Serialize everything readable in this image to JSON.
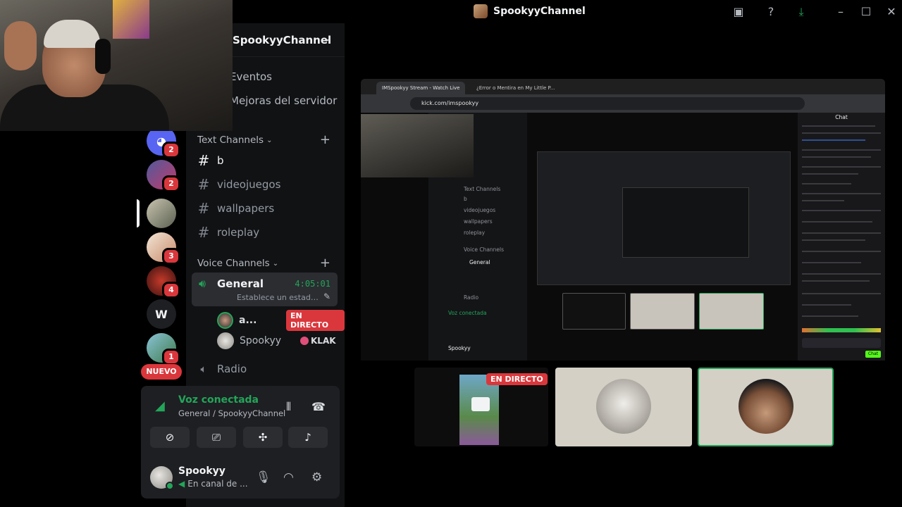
{
  "window": {
    "title": "SpookyyChannel",
    "icons": [
      "inbox-icon",
      "help-icon",
      "download-icon",
      "minimize-icon",
      "maximize-icon",
      "close-icon"
    ]
  },
  "servers": [
    {
      "name": "discord",
      "badge": "2",
      "color": "#5865f2"
    },
    {
      "name": "server-2",
      "badge": "2",
      "color": "#4e5a9c"
    },
    {
      "name": "server-3",
      "badge": "",
      "color": "#8a8f7a"
    },
    {
      "name": "server-4",
      "badge": "3",
      "color": "#e9d8c4"
    },
    {
      "name": "server-5",
      "badge": "4",
      "color": "#5a1f1f"
    },
    {
      "name": "server-w",
      "label": "W",
      "badge": "",
      "color": "#1e1f22"
    },
    {
      "name": "server-7",
      "badge": "1",
      "color": "#6aa0b4"
    }
  ],
  "nuevo_label": "NUEVO",
  "sidebar": {
    "server_name": "SpookyyChannel",
    "menu": [
      "Eventos",
      "Mejoras del servidor"
    ],
    "text_category": "Text Channels",
    "text_channels": [
      "b",
      "videojuegos",
      "wallpapers",
      "roleplay"
    ],
    "voice_category": "Voice Channels",
    "voice_channel": {
      "name": "General",
      "time": "4:05:01",
      "status": "Establece un estado de canal"
    },
    "voice_users": [
      {
        "name": "a...",
        "badge": "EN DIRECTO"
      },
      {
        "name": "Spookyy",
        "badge": "KLAK"
      }
    ],
    "radio_channel": "Radio"
  },
  "voice_panel": {
    "title": "Voz conectada",
    "subtitle": "General / SpookyyChannel"
  },
  "user_panel": {
    "name": "Spookyy",
    "status": "En canal de ..."
  },
  "stream": {
    "tabs": [
      "IMSpookyy Stream - Watch Live",
      "¿Error o Mentira en My Little P..."
    ],
    "url": "kick.com/imspookyy",
    "chat_title": "Chat",
    "chat_button": "Chat"
  },
  "tiles": {
    "live_label": "EN DIRECTO"
  },
  "colors": {
    "accent_green": "#23a55a",
    "live_red": "#da373c",
    "blurple": "#5865f2"
  }
}
